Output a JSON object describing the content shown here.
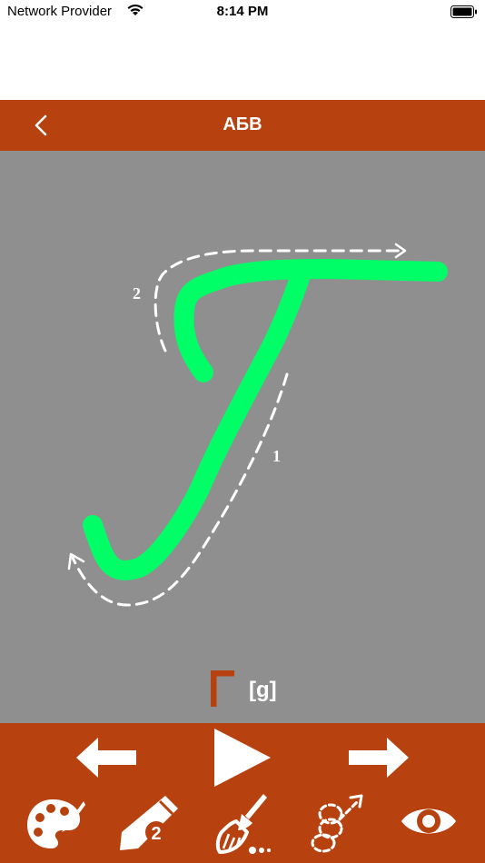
{
  "status_bar": {
    "carrier": "Network Provider",
    "time": "8:14 PM"
  },
  "nav": {
    "title": "АБВ",
    "back_icon": "chevron-left-icon"
  },
  "lesson": {
    "letter": "Г",
    "transcription": "[g]",
    "stroke_labels": [
      "1",
      "2"
    ]
  },
  "toolbar": {
    "row1": [
      "arrow-left-icon",
      "play-icon",
      "arrow-right-icon"
    ],
    "row2": [
      "palette-icon",
      "pencil-icon",
      "broom-icon",
      "trace-path-icon",
      "eye-icon"
    ],
    "pencil_badge": "2"
  },
  "colors": {
    "brand": "#b8420f",
    "canvas": "#8f8f8f",
    "trace": "#00ff66",
    "guide": "#ffffff"
  }
}
